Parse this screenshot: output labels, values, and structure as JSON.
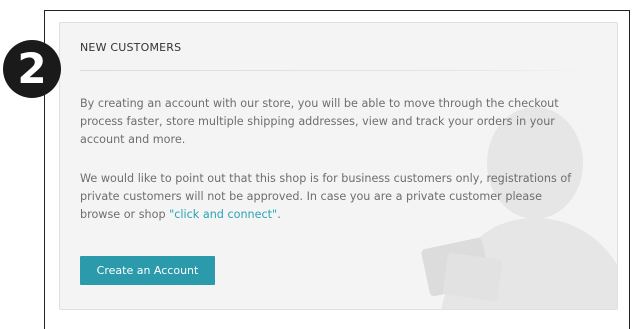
{
  "step_badge": "2",
  "panel": {
    "heading": "NEW CUSTOMERS",
    "paragraph1": "By creating an account with our store, you will be able to move through the checkout process faster, store multiple shipping addresses, view and track your orders in your account and more.",
    "paragraph2_before_link": "We would like to point out that this shop is for business customers only, registrations of private customers will not be approved. In case you are a private customer please browse or shop ",
    "paragraph2_link": "\"click and connect\"",
    "paragraph2_after_link": ".",
    "create_account_label": "Create an Account"
  },
  "colors": {
    "accent": "#2b9bab",
    "link": "#2aa3b5",
    "badge": "#1a1a1a"
  },
  "icons": {
    "watermark": "user-silhouette-icon"
  }
}
